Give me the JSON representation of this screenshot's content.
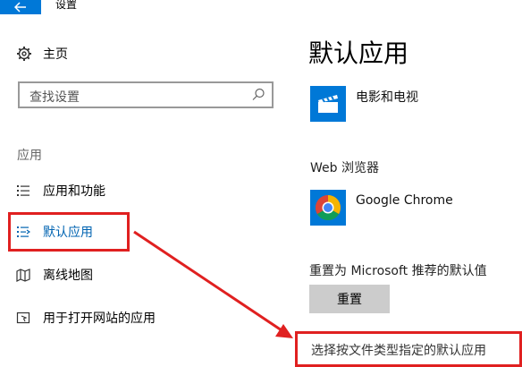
{
  "window": {
    "title": "设置"
  },
  "sidebar": {
    "home_label": "主页",
    "search_placeholder": "查找设置",
    "section_label": "应用",
    "items": [
      {
        "label": "应用和功能",
        "icon": "apps-features-icon"
      },
      {
        "label": "默认应用",
        "icon": "default-apps-icon",
        "active": true
      },
      {
        "label": "离线地图",
        "icon": "offline-maps-icon"
      },
      {
        "label": "用于打开网站的应用",
        "icon": "apps-for-websites-icon"
      }
    ]
  },
  "main": {
    "title": "默认应用",
    "video_app": {
      "name": "电影和电视",
      "icon": "film-clapper-icon"
    },
    "web_browser_label": "Web 浏览器",
    "browser_app": {
      "name": "Google Chrome",
      "icon": "chrome-icon"
    },
    "reset_label": "重置为 Microsoft 推荐的默认值",
    "reset_button": "重置",
    "bottom_link": "选择按文件类型指定的默认应用"
  },
  "colors": {
    "accent": "#0078d7",
    "annotation_red": "#e02020",
    "active_nav": "#0063b1"
  }
}
